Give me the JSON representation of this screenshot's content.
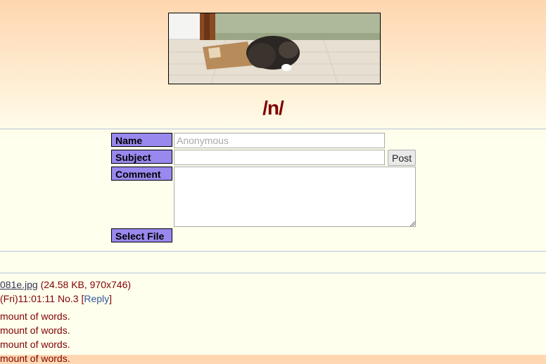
{
  "board": {
    "title": "/n/"
  },
  "form": {
    "name_label": "Name",
    "name_placeholder": "Anonymous",
    "subject_label": "Subject",
    "post_button": "Post",
    "comment_label": "Comment",
    "select_file_label": "Select File"
  },
  "post": {
    "file_link": "081e.jpg",
    "file_info": "(24.58 KB, 970x746)",
    "date_time": "(Fri)11:01:11",
    "number": "No.3",
    "reply_open": "[",
    "reply_label": "Reply",
    "reply_close": "]",
    "lines": [
      "mount of words.",
      "mount of words.",
      "mount of words.",
      "mount of words."
    ]
  },
  "colors": {
    "label_bg": "#9988ee",
    "title": "#800000",
    "link": "#34345c"
  }
}
